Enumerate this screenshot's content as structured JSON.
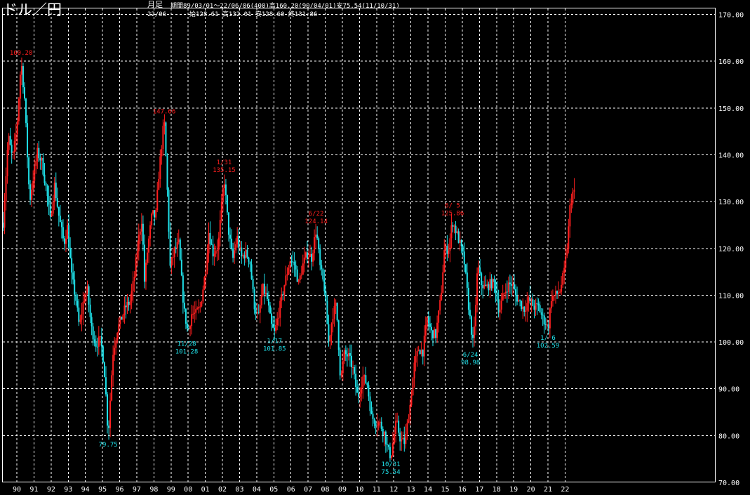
{
  "chart_title": "ドル／円",
  "header": {
    "timeframe_label": "月足",
    "period_info": "期間89/03/01～22/06/06(400)高160.20(90/04/01)安75.54(11/10/31)",
    "last_bar_date": "22/06",
    "last_bar_ohlc": "始128.61 高132.01 安128.60 終131.86"
  },
  "colors": {
    "up": "#ff1f1f",
    "down": "#1fe0e8",
    "grid": "#ffffff",
    "background": "#000000"
  },
  "chart_data": {
    "type": "candlestick",
    "title": "ドル／円",
    "xlabel": "",
    "ylabel": "",
    "ylim": [
      70,
      170
    ],
    "y_ticks": [
      "70.00",
      "80.00",
      "90.00",
      "100.00",
      "110.00",
      "120.00",
      "130.00",
      "140.00",
      "150.00",
      "160.00",
      "170.00"
    ],
    "x_tick_labels": [
      "90",
      "91",
      "92",
      "93",
      "94",
      "95",
      "96",
      "97",
      "98",
      "99",
      "00",
      "01",
      "02",
      "03",
      "04",
      "05",
      "06",
      "07",
      "08",
      "09",
      "10",
      "11",
      "12",
      "13",
      "14",
      "15",
      "16",
      "17",
      "18",
      "19",
      "20",
      "21",
      "22"
    ],
    "x_range_years": [
      1989.2,
      2022.5
    ],
    "grid": true,
    "series": [
      {
        "values": [
          [
            1989.2,
            125.5
          ],
          [
            1989.5,
            144
          ],
          [
            1989.75,
            139
          ],
          [
            1990.0,
            145.5
          ],
          [
            1990.25,
            160.2
          ],
          [
            1990.45,
            152
          ],
          [
            1990.75,
            130
          ],
          [
            1990.95,
            135
          ],
          [
            1991.2,
            140.5
          ],
          [
            1991.45,
            138.5
          ],
          [
            1991.75,
            132
          ],
          [
            1991.95,
            126
          ],
          [
            1992.2,
            133.5
          ],
          [
            1992.45,
            127
          ],
          [
            1992.75,
            121
          ],
          [
            1992.95,
            124.5
          ],
          [
            1993.2,
            114
          ],
          [
            1993.45,
            109
          ],
          [
            1993.65,
            103
          ],
          [
            1993.85,
            108
          ],
          [
            1994.1,
            111.5
          ],
          [
            1994.35,
            103
          ],
          [
            1994.6,
            99.5
          ],
          [
            1994.85,
            100.5
          ],
          [
            1995.0,
            98
          ],
          [
            1995.15,
            92
          ],
          [
            1995.33,
            79.75
          ],
          [
            1995.6,
            97.5
          ],
          [
            1995.85,
            102.5
          ],
          [
            1996.1,
            105
          ],
          [
            1996.35,
            107.5
          ],
          [
            1996.6,
            108.5
          ],
          [
            1996.85,
            113.5
          ],
          [
            1997.1,
            122
          ],
          [
            1997.3,
            126.5
          ],
          [
            1997.45,
            113
          ],
          [
            1997.65,
            120.5
          ],
          [
            1997.9,
            127.5
          ],
          [
            1998.1,
            126.5
          ],
          [
            1998.3,
            136.5
          ],
          [
            1998.6,
            147.66
          ],
          [
            1998.75,
            135.5
          ],
          [
            1998.95,
            116
          ],
          [
            1999.2,
            119.5
          ],
          [
            1999.45,
            121
          ],
          [
            1999.75,
            107
          ],
          [
            1999.99,
            102
          ],
          [
            2000.2,
            106
          ],
          [
            2000.45,
            106
          ],
          [
            2000.7,
            107.5
          ],
          [
            2000.99,
            114.5
          ],
          [
            2001.2,
            123.5
          ],
          [
            2001.45,
            119
          ],
          [
            2001.75,
            120.5
          ],
          [
            2002.0,
            131
          ],
          [
            2002.1,
            135.15
          ],
          [
            2002.35,
            124
          ],
          [
            2002.6,
            117.5
          ],
          [
            2002.85,
            122.5
          ],
          [
            2003.1,
            118
          ],
          [
            2003.35,
            119
          ],
          [
            2003.6,
            117.5
          ],
          [
            2003.85,
            108
          ],
          [
            2004.1,
            105
          ],
          [
            2004.35,
            111.5
          ],
          [
            2004.6,
            109.5
          ],
          [
            2004.85,
            103.5
          ],
          [
            2005.04,
            101.85
          ],
          [
            2005.3,
            106.5
          ],
          [
            2005.6,
            112
          ],
          [
            2005.95,
            117.5
          ],
          [
            2006.2,
            116.5
          ],
          [
            2006.45,
            112.5
          ],
          [
            2006.7,
            116.5
          ],
          [
            2006.95,
            119
          ],
          [
            2007.2,
            118
          ],
          [
            2007.47,
            124.14
          ],
          [
            2007.7,
            116
          ],
          [
            2007.95,
            111.5
          ],
          [
            2008.2,
            100
          ],
          [
            2008.45,
            106
          ],
          [
            2008.65,
            108
          ],
          [
            2008.9,
            91.5
          ],
          [
            2009.1,
            97.5
          ],
          [
            2009.35,
            97
          ],
          [
            2009.6,
            94.5
          ],
          [
            2009.9,
            88
          ],
          [
            2010.2,
            92.5
          ],
          [
            2010.45,
            91
          ],
          [
            2010.7,
            84
          ],
          [
            2010.95,
            83
          ],
          [
            2011.2,
            82.5
          ],
          [
            2011.45,
            80.5
          ],
          [
            2011.65,
            77
          ],
          [
            2011.83,
            75.54
          ],
          [
            2012.15,
            83
          ],
          [
            2012.4,
            79
          ],
          [
            2012.65,
            78.5
          ],
          [
            2012.95,
            86.5
          ],
          [
            2013.2,
            95
          ],
          [
            2013.45,
            98.5
          ],
          [
            2013.7,
            98
          ],
          [
            2013.95,
            105
          ],
          [
            2014.2,
            102
          ],
          [
            2014.45,
            101.5
          ],
          [
            2014.75,
            109.5
          ],
          [
            2014.95,
            119.5
          ],
          [
            2015.2,
            120
          ],
          [
            2015.43,
            125.86
          ],
          [
            2015.65,
            123.5
          ],
          [
            2015.9,
            120.5
          ],
          [
            2016.1,
            117.5
          ],
          [
            2016.4,
            106.5
          ],
          [
            2016.65,
            98.9
          ],
          [
            2016.9,
            116.5
          ],
          [
            2017.1,
            112.5
          ],
          [
            2017.35,
            111.5
          ],
          [
            2017.65,
            112.5
          ],
          [
            2017.9,
            112.5
          ],
          [
            2018.15,
            106.5
          ],
          [
            2018.4,
            110
          ],
          [
            2018.65,
            112
          ],
          [
            2018.9,
            112.5
          ],
          [
            2019.1,
            110
          ],
          [
            2019.35,
            108.5
          ],
          [
            2019.6,
            107
          ],
          [
            2019.9,
            109
          ],
          [
            2020.2,
            107.5
          ],
          [
            2020.45,
            107.5
          ],
          [
            2020.7,
            105
          ],
          [
            2020.9,
            104
          ],
          [
            2021.0,
            102.59
          ],
          [
            2021.2,
            109.5
          ],
          [
            2021.45,
            110
          ],
          [
            2021.7,
            111
          ],
          [
            2021.95,
            115
          ],
          [
            2022.15,
            121.5
          ],
          [
            2022.3,
            129.5
          ],
          [
            2022.45,
            131.86
          ]
        ]
      }
    ],
    "annotations": [
      {
        "kind": "high",
        "date": "",
        "value": "160.20",
        "year": 1990.25,
        "price": 160.2
      },
      {
        "kind": "high",
        "date": "",
        "value": "147.66",
        "year": 1998.6,
        "price": 147.66
      },
      {
        "kind": "high",
        "date": "1/31",
        "value": "135.15",
        "year": 2002.1,
        "price": 135.15
      },
      {
        "kind": "high",
        "date": "6/22",
        "value": "124.14",
        "year": 2007.47,
        "price": 124.14
      },
      {
        "kind": "high",
        "date": "6/ 5",
        "value": "125.86",
        "year": 2015.43,
        "price": 125.86
      },
      {
        "kind": "low",
        "date": "",
        "value": "79.75",
        "year": 1995.33,
        "price": 79.75
      },
      {
        "kind": "low",
        "date": "11/28",
        "value": "101.28",
        "year": 1999.91,
        "price": 101.28
      },
      {
        "kind": "low",
        "date": "1/17",
        "value": "101.85",
        "year": 2005.04,
        "price": 101.85
      },
      {
        "kind": "low",
        "date": "10/31",
        "value": "75.54",
        "year": 2011.83,
        "price": 75.54
      },
      {
        "kind": "low",
        "date": "6/24",
        "value": "98.98",
        "year": 2016.48,
        "price": 98.98
      },
      {
        "kind": "low",
        "date": "1/ 6",
        "value": "102.59",
        "year": 2021.0,
        "price": 102.59
      }
    ]
  }
}
